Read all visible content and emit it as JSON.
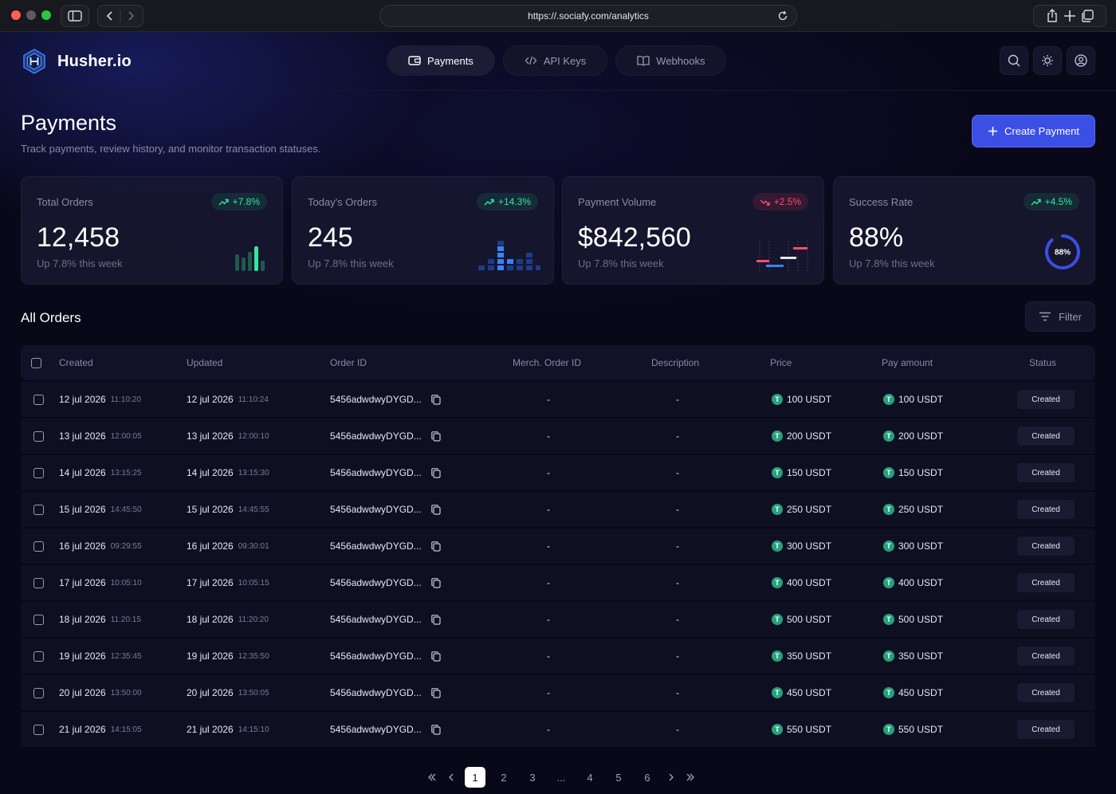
{
  "browser": {
    "url": "https://.sociafy.com/analytics"
  },
  "app": {
    "name": "Husher.io",
    "nav": [
      {
        "label": "Payments",
        "active": true
      },
      {
        "label": "API Keys",
        "active": false
      },
      {
        "label": "Webhooks",
        "active": false
      }
    ]
  },
  "page": {
    "title": "Payments",
    "subtitle": "Track payments, review history, and monitor transaction statuses.",
    "create_label": "Create Payment"
  },
  "stats": [
    {
      "label": "Total Orders",
      "value": "12,458",
      "change": "+7.8%",
      "trend": "up",
      "sub": "Up 7.8% this week"
    },
    {
      "label": "Today's Orders",
      "value": "245",
      "change": "+14.3%",
      "trend": "up",
      "sub": "Up 7.8% this week"
    },
    {
      "label": "Payment Volume",
      "value": "$842,560",
      "change": "+2.5%",
      "trend": "down",
      "sub": "Up 7.8% this week"
    },
    {
      "label": "Success Rate",
      "value": "88%",
      "change": "+4.5%",
      "trend": "up",
      "sub": "Up 7.8% this week",
      "gauge_label": "88%",
      "gauge_fraction": 0.88
    }
  ],
  "orders": {
    "title": "All Orders",
    "filter_label": "Filter",
    "columns": [
      "Created",
      "Updated",
      "Order ID",
      "Merch. Order ID",
      "Description",
      "Price",
      "Pay amount",
      "Status"
    ],
    "rows": [
      {
        "created_date": "12 jul 2026",
        "created_time": "11:10:20",
        "updated_date": "12 jul 2026",
        "updated_time": "11:10:24",
        "order_id": "5456adwdwyDYGD...",
        "merch_id": "-",
        "description": "-",
        "price": "100 USDT",
        "pay": "100 USDT",
        "status": "Created"
      },
      {
        "created_date": "13 jul 2026",
        "created_time": "12:00:05",
        "updated_date": "13 jul 2026",
        "updated_time": "12:00:10",
        "order_id": "5456adwdwyDYGD...",
        "merch_id": "-",
        "description": "-",
        "price": "200 USDT",
        "pay": "200 USDT",
        "status": "Created"
      },
      {
        "created_date": "14 jul 2026",
        "created_time": "13:15:25",
        "updated_date": "14 jul 2026",
        "updated_time": "13:15:30",
        "order_id": "5456adwdwyDYGD...",
        "merch_id": "-",
        "description": "-",
        "price": "150 USDT",
        "pay": "150 USDT",
        "status": "Created"
      },
      {
        "created_date": "15 jul 2026",
        "created_time": "14:45:50",
        "updated_date": "15 jul 2026",
        "updated_time": "14:45:55",
        "order_id": "5456adwdwyDYGD...",
        "merch_id": "-",
        "description": "-",
        "price": "250 USDT",
        "pay": "250 USDT",
        "status": "Created"
      },
      {
        "created_date": "16 jul 2026",
        "created_time": "09:29:55",
        "updated_date": "16 jul 2026",
        "updated_time": "09:30:01",
        "order_id": "5456adwdwyDYGD...",
        "merch_id": "-",
        "description": "-",
        "price": "300 USDT",
        "pay": "300 USDT",
        "status": "Created"
      },
      {
        "created_date": "17 jul 2026",
        "created_time": "10:05:10",
        "updated_date": "17 jul 2026",
        "updated_time": "10:05:15",
        "order_id": "5456adwdwyDYGD...",
        "merch_id": "-",
        "description": "-",
        "price": "400 USDT",
        "pay": "400 USDT",
        "status": "Created"
      },
      {
        "created_date": "18 jul 2026",
        "created_time": "11:20:15",
        "updated_date": "18 jul 2026",
        "updated_time": "11:20:20",
        "order_id": "5456adwdwyDYGD...",
        "merch_id": "-",
        "description": "-",
        "price": "500 USDT",
        "pay": "500 USDT",
        "status": "Created"
      },
      {
        "created_date": "19 jul 2026",
        "created_time": "12:35:45",
        "updated_date": "19 jul 2026",
        "updated_time": "12:35:50",
        "order_id": "5456adwdwyDYGD...",
        "merch_id": "-",
        "description": "-",
        "price": "350 USDT",
        "pay": "350 USDT",
        "status": "Created"
      },
      {
        "created_date": "20 jul 2026",
        "created_time": "13:50:00",
        "updated_date": "20 jul 2026",
        "updated_time": "13:50:05",
        "order_id": "5456adwdwyDYGD...",
        "merch_id": "-",
        "description": "-",
        "price": "450 USDT",
        "pay": "450 USDT",
        "status": "Created"
      },
      {
        "created_date": "21 jul 2026",
        "created_time": "14:15:05",
        "updated_date": "21 jul 2026",
        "updated_time": "14:15:10",
        "order_id": "5456adwdwyDYGD...",
        "merch_id": "-",
        "description": "-",
        "price": "550 USDT",
        "pay": "550 USDT",
        "status": "Created"
      }
    ]
  },
  "pagination": {
    "pages": [
      "1",
      "2",
      "3",
      "...",
      "4",
      "5",
      "6"
    ],
    "current": "1"
  },
  "colors": {
    "accent": "#3b4fe4",
    "positive": "#34e6a0",
    "negative": "#ff4d6d",
    "usdt": "#26a17b"
  },
  "icons": {
    "nav": [
      "wallet-icon",
      "code-icon",
      "book-icon"
    ],
    "header_tools": [
      "search-icon",
      "sun-icon",
      "user-icon"
    ],
    "currency": "usdt-coin-icon"
  }
}
